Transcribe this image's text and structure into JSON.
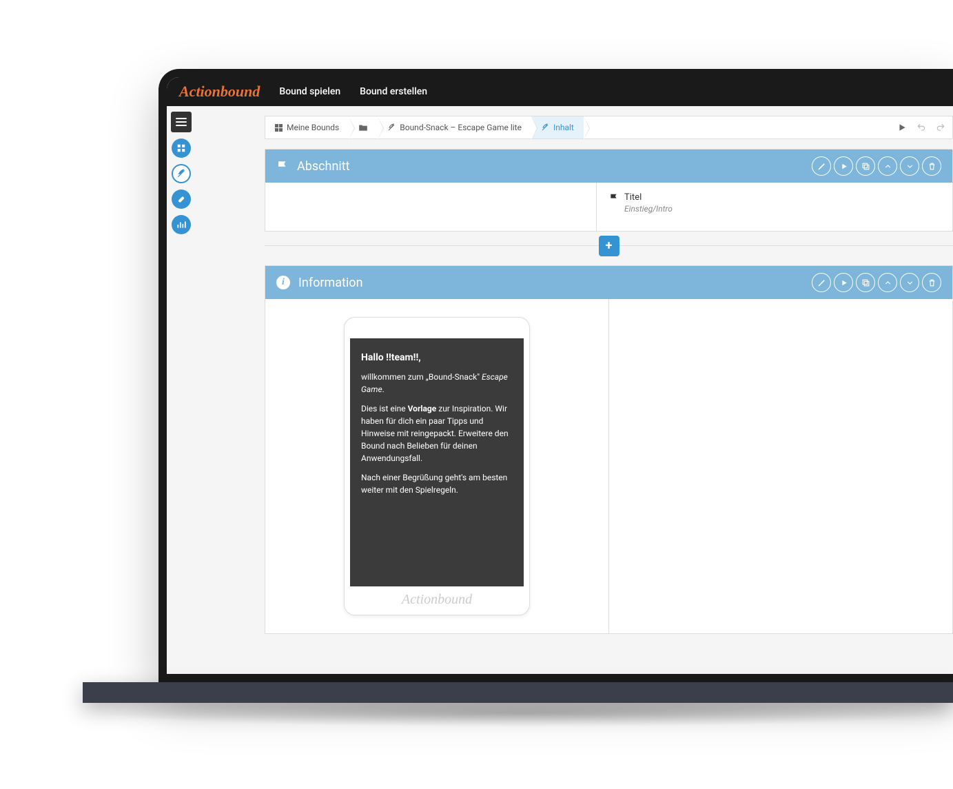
{
  "brand": "Actionbound",
  "topnav": {
    "play": "Bound spielen",
    "create": "Bound erstellen"
  },
  "breadcrumbs": {
    "myBounds": "Meine Bounds",
    "boundName": "Bound-Snack – Escape Game lite",
    "content": "Inhalt"
  },
  "sections": {
    "abschnitt": {
      "title": "Abschnitt",
      "field": {
        "label": "Titel",
        "value": "Einstieg/Intro"
      }
    },
    "information": {
      "title": "Information",
      "preview": {
        "heading": "Hallo !!team!!,",
        "line1Prefix": "willkommen zum „Bound-Snack\" ",
        "line1Suffix": "Escape Game",
        "line1End": ".",
        "line2Prefix": "Dies ist eine ",
        "line2Bold": "Vorlage",
        "line2Suffix": " zur Inspiration. Wir haben für dich ein paar Tipps und Hinweise mit reingepackt. Erweitere den Bound nach Belieben für deinen Anwendungsfall.",
        "line3": "Nach einer Begrüßung geht's am besten weiter mit den Spielregeln."
      },
      "previewBrand": "Actionbound"
    }
  },
  "addButton": "+"
}
